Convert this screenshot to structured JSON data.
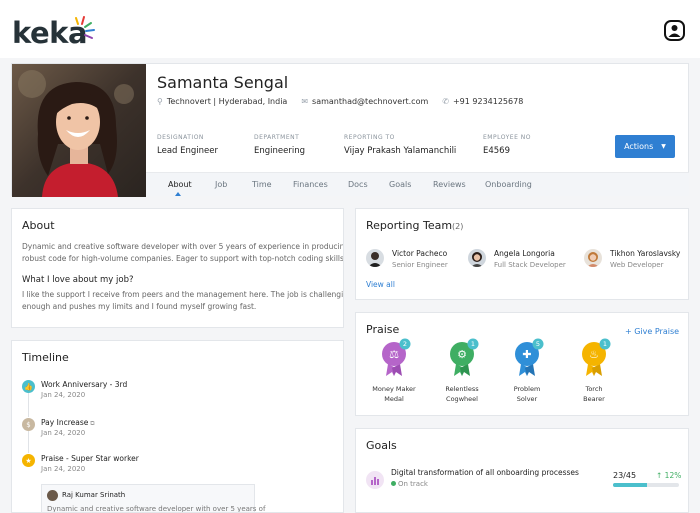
{
  "brand": {
    "logo": "keka"
  },
  "profile": {
    "name": "Samanta Sengal",
    "location": "Technovert | Hyderabad, India",
    "email": "samanthad@technovert.com",
    "phone": "+91 9234125678",
    "fields": [
      {
        "label": "DESIGNATION",
        "value": "Lead Engineer"
      },
      {
        "label": "DEPARTMENT",
        "value": "Engineering"
      },
      {
        "label": "REPORTING TO",
        "value": "Vijay Prakash Yalamanchili"
      },
      {
        "label": "EMPLOYEE NO",
        "value": "E4569"
      }
    ],
    "actions_label": "Actions"
  },
  "tabs": [
    "About",
    "Job",
    "Time",
    "Finances",
    "Docs",
    "Goals",
    "Reviews",
    "Onboarding"
  ],
  "about": {
    "title": "About",
    "line1": "Dynamic and creative software developer with over 5 years of experience in producing",
    "line2": "robust code for high-volume companies. Eager to support with top-notch coding skills.",
    "love_title": "What I love about my job?",
    "love_line1": "I like the support I receive from peers and the management here. The job is challenging",
    "love_line2": "enough and pushes my limits and I found myself growing fast."
  },
  "timeline": {
    "title": "Timeline",
    "items": [
      {
        "title": "Work Anniversary - 3rd",
        "date": "Jan 24, 2020"
      },
      {
        "title": "Pay Increase",
        "date": "Jan 24, 2020"
      },
      {
        "title": "Praise - Super Star worker",
        "date": "Jan 24, 2020"
      }
    ],
    "comment_author": "Raj Kumar Srinath",
    "comment_text": "Dynamic and creative software developer with over 5 years of"
  },
  "reporting": {
    "title": "Reporting Team",
    "count": "(2)",
    "people": [
      {
        "name": "Victor Pacheco",
        "role": "Senior Engineer"
      },
      {
        "name": "Angela Longoria",
        "role": "Full Stack Developer"
      },
      {
        "name": "Tikhon Yaroslavsky",
        "role": "Web Developer"
      }
    ],
    "view_all": "View all"
  },
  "praise": {
    "title": "Praise",
    "give_label": "Give Praise",
    "badges": [
      {
        "line1": "Money Maker",
        "line2": "Medal",
        "count": "2",
        "color": "#b565c9"
      },
      {
        "line1": "Relentless",
        "line2": "Cogwheel",
        "count": "1",
        "color": "#3fae63"
      },
      {
        "line1": "Problem",
        "line2": "Solver",
        "count": "5",
        "color": "#2f8fd8"
      },
      {
        "line1": "Torch",
        "line2": "Bearer",
        "count": "1",
        "color": "#f5b400"
      }
    ]
  },
  "goals": {
    "title": "Goals",
    "item_title": "Digital transformation of all onboarding processes",
    "status": "On track",
    "progress": "23/45",
    "change": "↑ 12%",
    "progress_fraction": 0.51
  }
}
